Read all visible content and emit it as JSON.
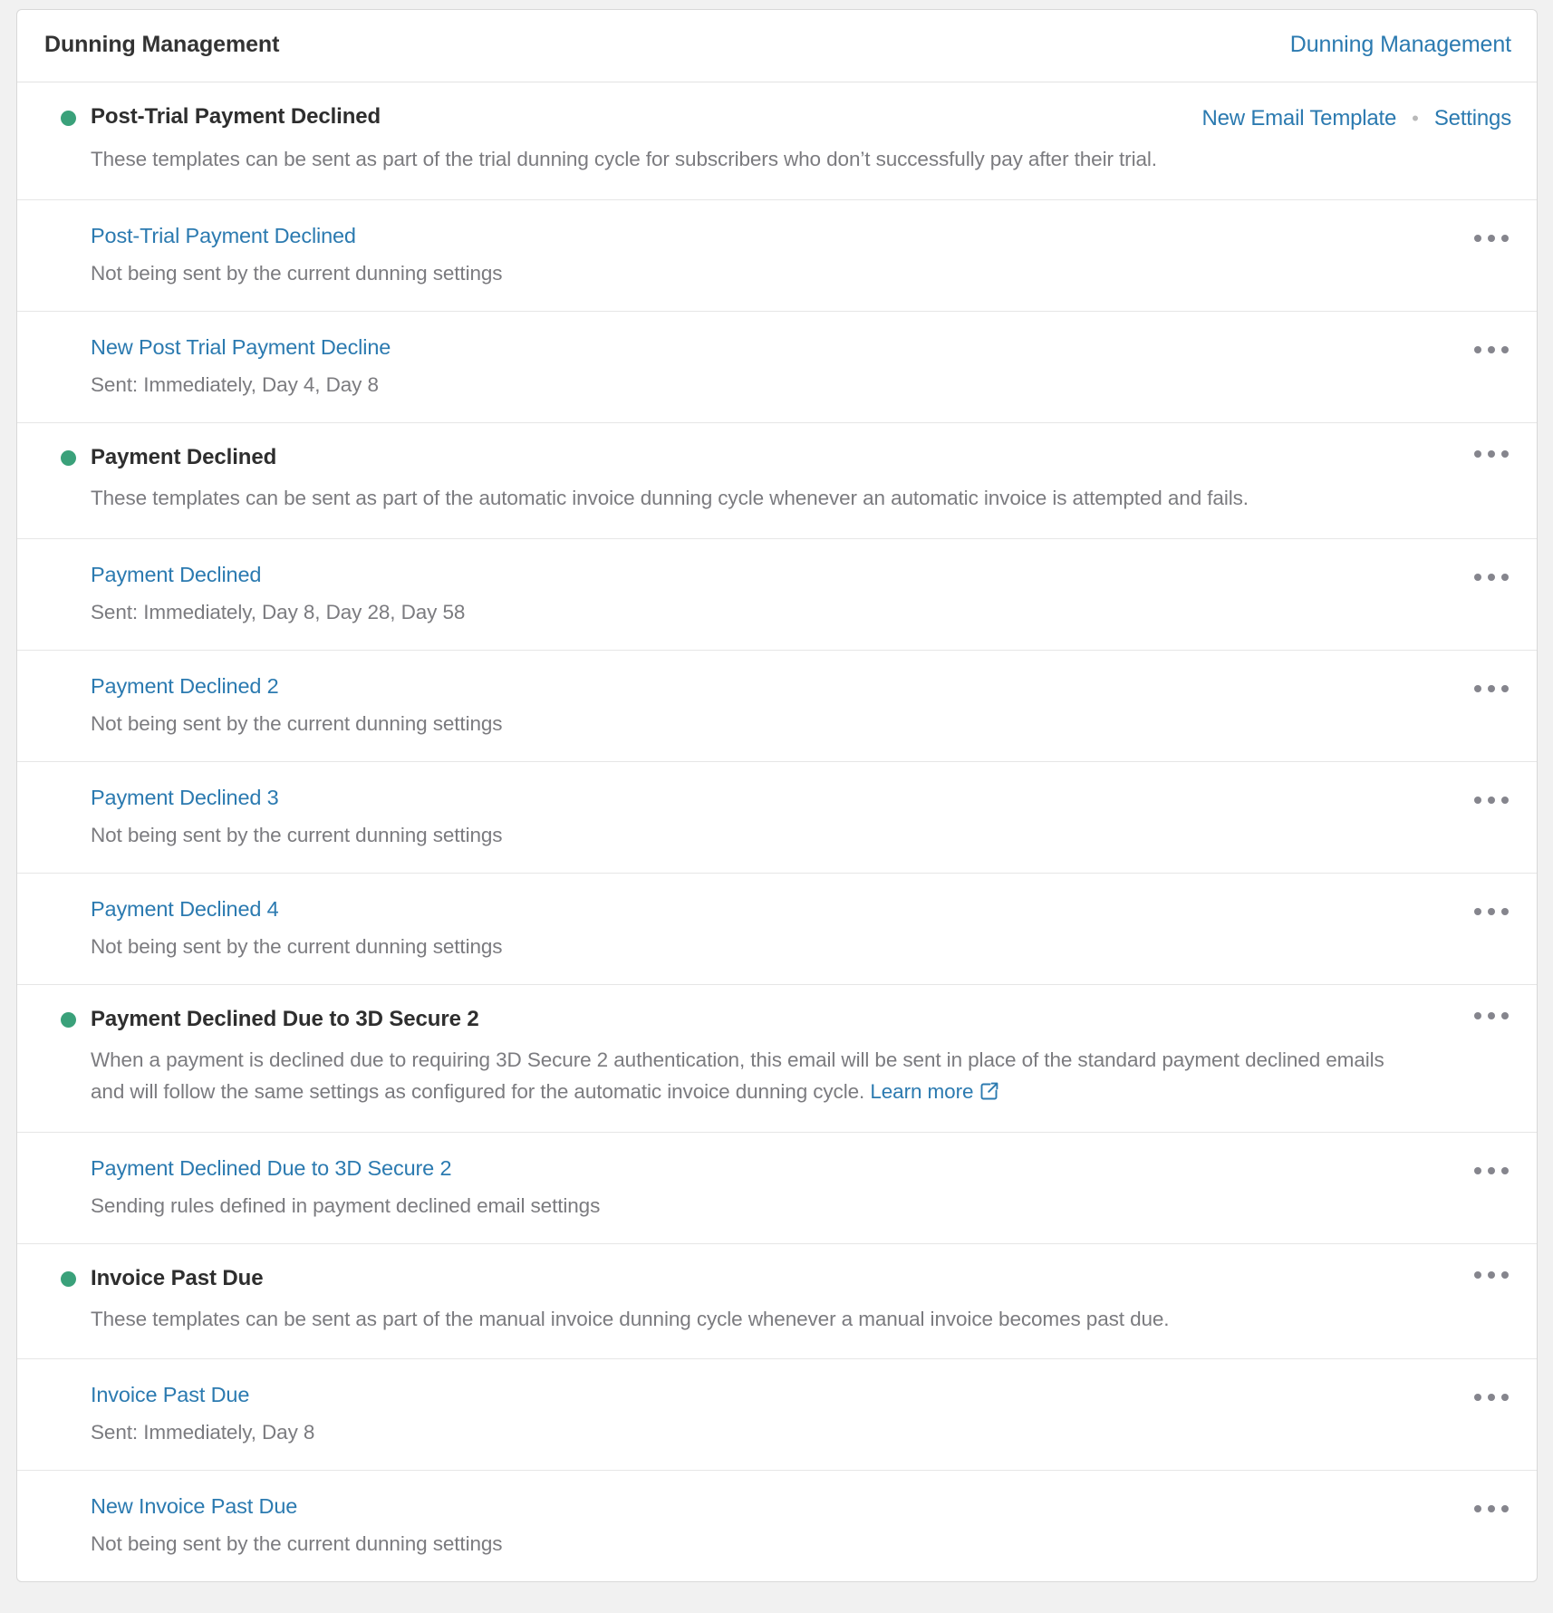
{
  "header": {
    "title": "Dunning Management",
    "link_label": "Dunning Management"
  },
  "colors": {
    "link": "#2b7ab0",
    "status_dot": "#3aa17a",
    "muted_text": "#7b7b7f",
    "title_text": "#333333",
    "page_background": "#f1f1f1",
    "card_background": "#ffffff",
    "border": "#e6e6e6"
  },
  "groups": [
    {
      "title": "Post-Trial Payment Declined",
      "description": "These templates can be sent as part of the trial dunning cycle for subscribers who don’t successfully pay after their trial.",
      "status": "active",
      "actions": {
        "new_template_label": "New Email Template",
        "separator": "•",
        "settings_label": "Settings"
      },
      "has_menu": false,
      "templates": [
        {
          "name": "Post-Trial Payment Declined",
          "status": "Not being sent by the current dunning settings"
        },
        {
          "name": "New Post Trial Payment Decline",
          "status": "Sent: Immediately, Day 4, Day 8"
        }
      ]
    },
    {
      "title": "Payment Declined",
      "description": "These templates can be sent as part of the automatic invoice dunning cycle whenever an automatic invoice is attempted and fails.",
      "status": "active",
      "has_menu": true,
      "templates": [
        {
          "name": "Payment Declined",
          "status": "Sent: Immediately, Day 8, Day 28, Day 58"
        },
        {
          "name": "Payment Declined 2",
          "status": "Not being sent by the current dunning settings"
        },
        {
          "name": "Payment Declined 3",
          "status": "Not being sent by the current dunning settings"
        },
        {
          "name": "Payment Declined 4",
          "status": "Not being sent by the current dunning settings"
        }
      ]
    },
    {
      "title": "Payment Declined Due to 3D Secure 2",
      "description": "When a payment is declined due to requiring 3D Secure 2 authentication, this email will be sent in place of the standard payment declined emails and will follow the same settings as configured for the automatic invoice dunning cycle.",
      "learn_more_label": "Learn more",
      "status": "active",
      "has_menu": true,
      "templates": [
        {
          "name": "Payment Declined Due to 3D Secure 2",
          "status": "Sending rules defined in payment declined email settings"
        }
      ]
    },
    {
      "title": "Invoice Past Due",
      "description": "These templates can be sent as part of the manual invoice dunning cycle whenever a manual invoice becomes past due.",
      "status": "active",
      "has_menu": true,
      "templates": [
        {
          "name": "Invoice Past Due",
          "status": "Sent: Immediately, Day 8"
        },
        {
          "name": "New Invoice Past Due",
          "status": "Not being sent by the current dunning settings"
        }
      ]
    }
  ]
}
